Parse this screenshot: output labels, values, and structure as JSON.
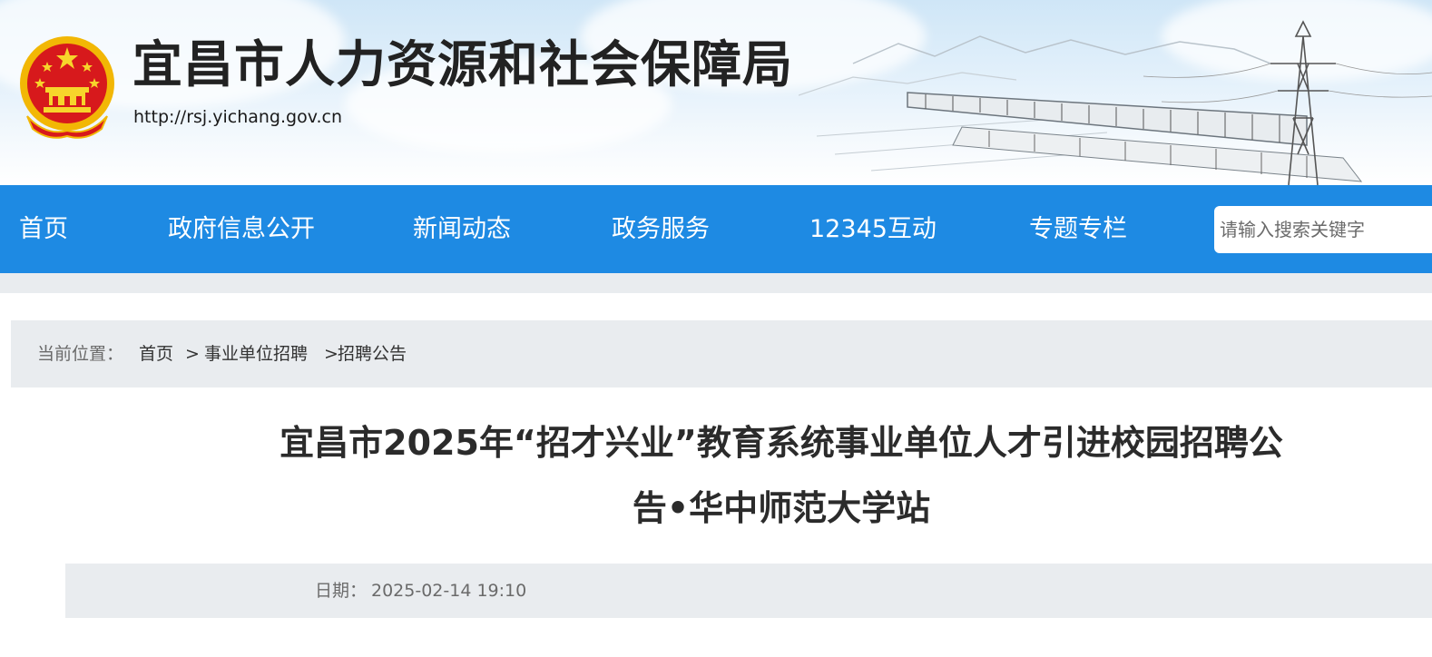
{
  "header": {
    "site_title": "宜昌市人力资源和社会保障局",
    "site_url": "http://rsj.yichang.gov.cn",
    "emblem": "national-emblem"
  },
  "nav": {
    "items": [
      {
        "label": "首页"
      },
      {
        "label": "政府信息公开"
      },
      {
        "label": "新闻动态"
      },
      {
        "label": "政务服务"
      },
      {
        "label": "12345互动"
      },
      {
        "label": "专题专栏"
      }
    ],
    "search_placeholder": "请输入搜索关键字"
  },
  "breadcrumb": {
    "label": "当前位置：",
    "items": [
      "首页",
      "事业单位招聘",
      "招聘公告"
    ],
    "separator": ">"
  },
  "article": {
    "title_line1": "宜昌市2025年“招才兴业”教育系统事业单位人才引进校园招聘公",
    "title_line2": "告•华中师范大学站",
    "date_label": "日期：",
    "date_value": "2025-02-14 19:10"
  },
  "colors": {
    "nav_bg": "#1e8ae3",
    "gray_bg": "#e9ecef",
    "title_text": "#2b2b2b"
  }
}
